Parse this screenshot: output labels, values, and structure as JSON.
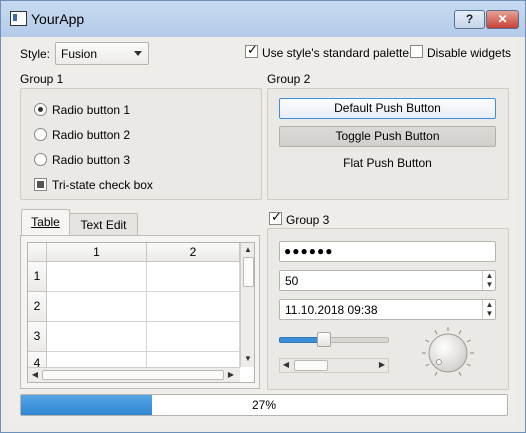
{
  "window": {
    "title": "YourApp",
    "help_label": "?",
    "close_label": "✕"
  },
  "topbar": {
    "style_label": "Style:",
    "style_value": "Fusion",
    "palette_label": "Use style's standard palette",
    "disable_label": "Disable widgets"
  },
  "group1": {
    "title": "Group 1",
    "radio1": "Radio button 1",
    "radio2": "Radio button 2",
    "radio3": "Radio button 3",
    "tristate": "Tri-state check box"
  },
  "group2": {
    "title": "Group 2",
    "default_btn": "Default Push Button",
    "toggle_btn": "Toggle Push Button",
    "flat_btn": "Flat Push Button"
  },
  "tabs": {
    "table": "Table",
    "text_edit": "Text Edit"
  },
  "table": {
    "col1": "1",
    "col2": "2",
    "rows": [
      "1",
      "2",
      "3",
      "4"
    ]
  },
  "group3": {
    "title": "Group 3",
    "password": "●●●●●●",
    "spin_value": "50",
    "datetime": "11.10.2018 09:38",
    "slider_fraction": 0.4
  },
  "progress": {
    "text": "27%",
    "fraction": 0.27
  },
  "colors": {
    "accent": "#3a8fd8",
    "titlebar": "#b9cfea",
    "close": "#c4423a"
  }
}
